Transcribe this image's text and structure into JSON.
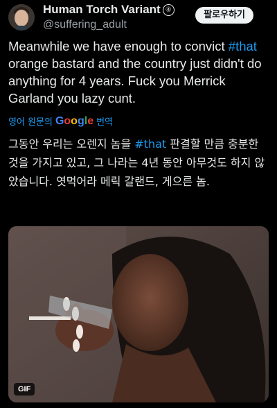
{
  "author": {
    "display_name": "Human Torch Variant",
    "badge": "④",
    "handle": "@suffering_adult"
  },
  "follow_button": {
    "label": "팔로우하기"
  },
  "tweet": {
    "before_hashtag": "Meanwhile we have enough to convict ",
    "hashtag": "#that",
    "after_hashtag": " orange bastard and the country just didn't do anything for 4 years. Fuck you Merrick Garland you lazy cunt."
  },
  "translation": {
    "prefix": "영어 원문의",
    "google": [
      "G",
      "o",
      "o",
      "g",
      "l",
      "e"
    ],
    "suffix": "번역",
    "before_hashtag": "그동안 우리는 오렌지 놈을 ",
    "hashtag": "#that",
    "after_hashtag": " 판결할 만큼 충분한 것을 가지고 있고, 그 나라는 4년 동안 아무것도 하지 않았습니다. 엿먹어라 메릭 갈랜드, 게으른 놈."
  },
  "media": {
    "gif_label": "GIF"
  },
  "colors": {
    "accent": "#1d9bf0",
    "background": "#000000",
    "text": "#e7e9ea"
  },
  "icons": {
    "avatar": "avatar-photo",
    "badge": "circled-number-badge"
  }
}
